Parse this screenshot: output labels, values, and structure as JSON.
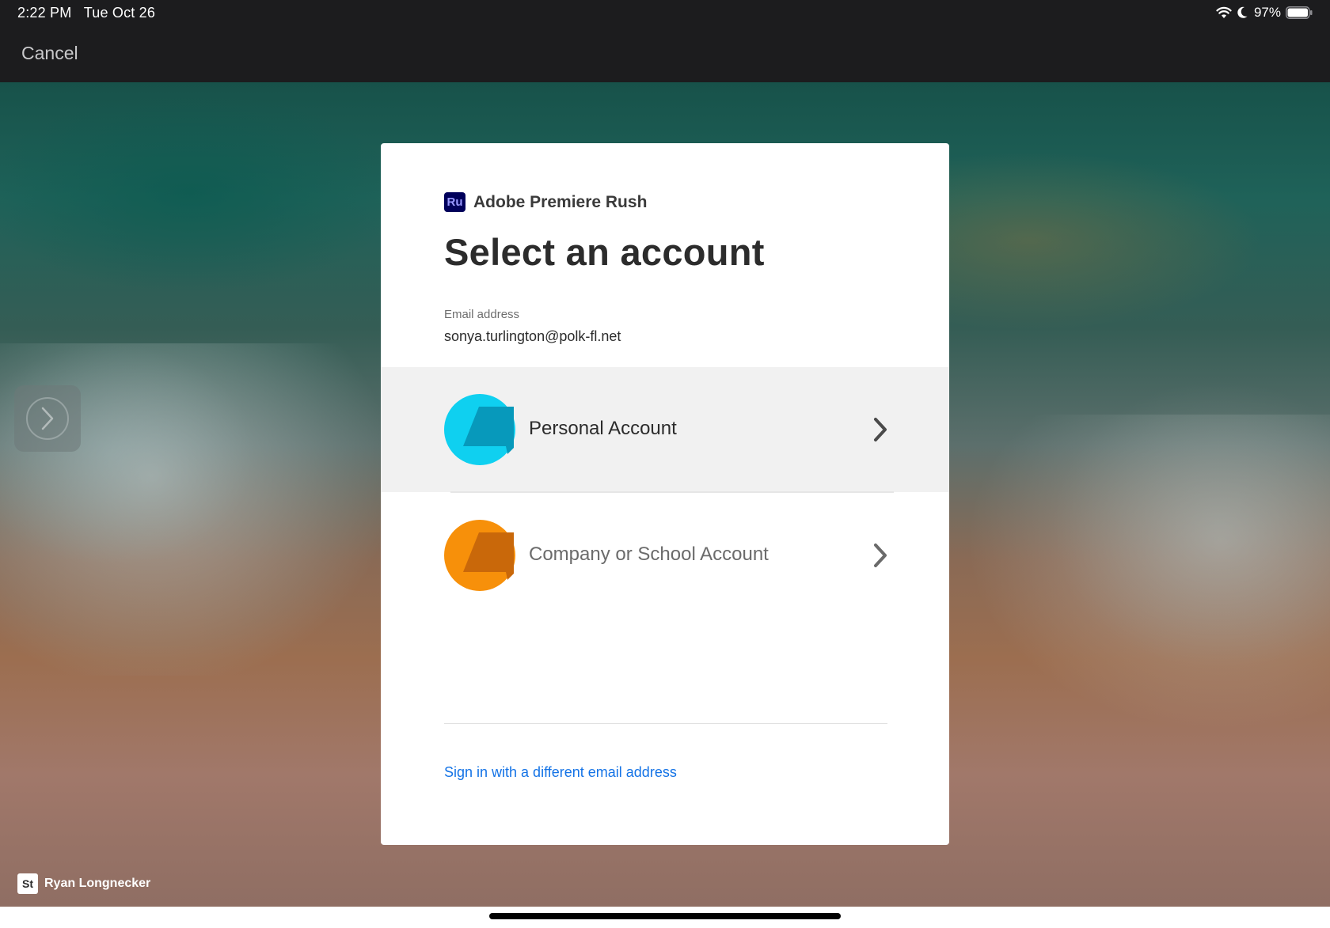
{
  "status_bar": {
    "time": "2:22 PM",
    "date": "Tue Oct 26",
    "battery": "97%",
    "icons": [
      "wifi-icon",
      "moon-icon",
      "battery-icon"
    ]
  },
  "nav": {
    "cancel_label": "Cancel"
  },
  "background": {
    "photo_credit": "Ryan Longnecker",
    "credit_logo_text": "St"
  },
  "dialog": {
    "app_icon_text": "Ru",
    "app_name": "Adobe Premiere Rush",
    "title": "Select an account",
    "email_label": "Email address",
    "email_value": "sonya.turlington@polk-fl.net",
    "accounts": [
      {
        "label": "Personal Account",
        "color": "#0fd0f0",
        "icon": "personal-account-avatar",
        "selected": true
      },
      {
        "label": "Company or School Account",
        "color": "#f7900a",
        "icon": "company-account-avatar",
        "selected": false
      }
    ],
    "alt_link": "Sign in with a different email address"
  },
  "colors": {
    "link": "#1473e6",
    "app_icon_bg": "#00005b",
    "app_icon_fg": "#9999ff",
    "topbar": "#1c1c1e"
  }
}
